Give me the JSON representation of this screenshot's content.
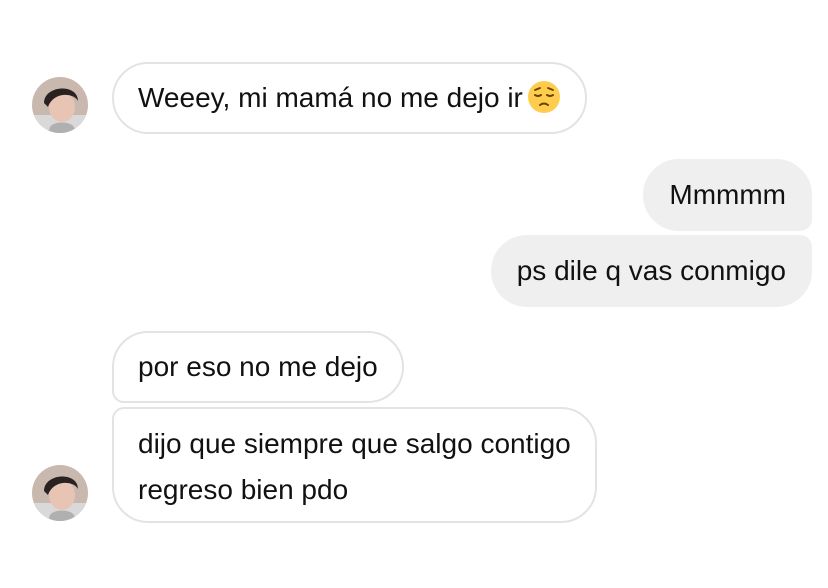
{
  "chat": {
    "messages": [
      {
        "direction": "incoming",
        "text": "Weeey, mi mamá no me dejo ir",
        "emoji": "pensive-face-emoji"
      },
      {
        "direction": "outgoing",
        "text": "Mmmmm"
      },
      {
        "direction": "outgoing",
        "text": "ps dile q vas conmigo"
      },
      {
        "direction": "incoming",
        "text": "por eso no me dejo"
      },
      {
        "direction": "incoming",
        "lines": [
          "dijo que siempre que salgo contigo",
          "regreso bien pdo"
        ]
      }
    ]
  },
  "colors": {
    "incoming_border": "#e3e3e3",
    "outgoing_bg": "#efefef",
    "text": "#111111",
    "emoji_face": "#ffcc4d"
  }
}
